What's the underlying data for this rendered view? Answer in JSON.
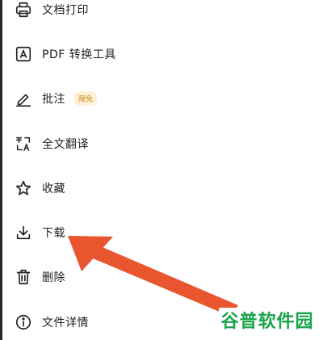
{
  "menu": {
    "items": [
      {
        "label": "文档打印",
        "icon": "printer-icon"
      },
      {
        "label": "PDF 转换工具",
        "icon": "pdf-convert-icon"
      },
      {
        "label": "批注",
        "icon": "pen-annotate-icon",
        "badge": "限免"
      },
      {
        "label": "全文翻译",
        "icon": "translate-icon"
      },
      {
        "label": "收藏",
        "icon": "star-icon"
      },
      {
        "label": "下载",
        "icon": "download-icon"
      },
      {
        "label": "删除",
        "icon": "trash-icon"
      },
      {
        "label": "文件详情",
        "icon": "info-icon"
      }
    ]
  },
  "annotation": {
    "arrow_color": "#e8552f",
    "points_to": "下载"
  },
  "watermark": {
    "part1": "谷普",
    "part2": "软件园"
  }
}
